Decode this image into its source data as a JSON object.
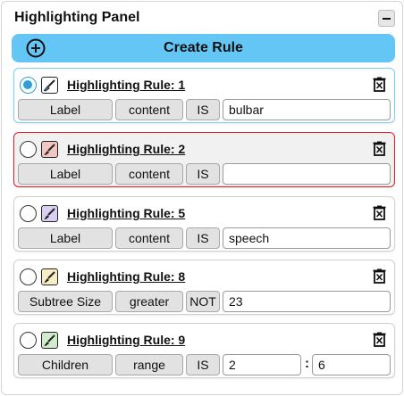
{
  "panel": {
    "title": "Highlighting Panel",
    "collapse_icon": "minus-icon",
    "create_label": "Create Rule",
    "create_icon": "plus-circle-icon"
  },
  "colors": {
    "create_button": "#63c6f5",
    "selected_border": "#7ccfee",
    "invalid_border": "#e21b2b",
    "radio_on": "#2a9fdb"
  },
  "rules": [
    {
      "title": "Highlighting Rule: 1",
      "selected": true,
      "invalid": false,
      "swatch_color": "#2c8fd8",
      "field": "Label",
      "comparator": "content",
      "operator": "IS",
      "value": "bulbar"
    },
    {
      "title": "Highlighting Rule: 2",
      "selected": false,
      "invalid": true,
      "swatch_color": "#f2c7c3",
      "field": "Label",
      "comparator": "content",
      "operator": "IS",
      "value": ""
    },
    {
      "title": "Highlighting Rule: 5",
      "selected": false,
      "invalid": false,
      "swatch_color": "#d9cff2",
      "field": "Label",
      "comparator": "content",
      "operator": "IS",
      "value": "speech"
    },
    {
      "title": "Highlighting Rule: 8",
      "selected": false,
      "invalid": false,
      "swatch_color": "#f8edc4",
      "field": "Subtree Size",
      "comparator": "greater",
      "operator": "NOT",
      "value": "23"
    },
    {
      "title": "Highlighting Rule: 9",
      "selected": false,
      "invalid": false,
      "swatch_color": "#cfeccb",
      "field": "Children",
      "comparator": "range",
      "operator": "IS",
      "value": "2",
      "separator": ":",
      "value_max": "6"
    }
  ],
  "icons": {
    "swatch": "paintbrush-icon",
    "delete": "trash-icon"
  }
}
